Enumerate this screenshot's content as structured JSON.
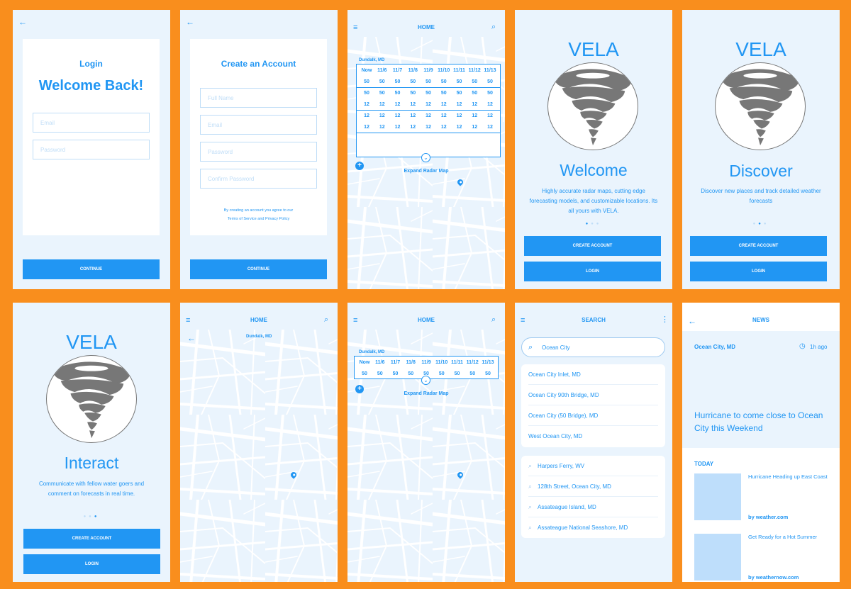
{
  "colors": {
    "background": "#F98E1D",
    "primary": "#2196F3",
    "screen_bg": "#EAF4FD",
    "tornado_gray": "#777777"
  },
  "icons": {
    "back": "arrow-left-icon",
    "menu": "hamburger-menu-icon",
    "search": "search-icon",
    "more": "more-vertical-icon",
    "add": "plus-circle-icon",
    "expand": "chevron-down-circle-icon",
    "location": "map-pin-icon",
    "clock": "clock-icon"
  },
  "login": {
    "title": "Login",
    "heading": "Welcome Back!",
    "email_placeholder": "Email",
    "password_placeholder": "Password",
    "continue_label": "CONTINUE"
  },
  "signup": {
    "title": "Create an Account",
    "full_name_placeholder": "Full Name",
    "email_placeholder": "Email",
    "password_placeholder": "Password",
    "confirm_placeholder": "Confirm Password",
    "terms_line1": "By creating an account you agree to our",
    "terms_line2": "Terms of Service and Privacy Policy",
    "continue_label": "CONTINUE"
  },
  "home": {
    "title": "HOME",
    "location": "Dundalk, MD",
    "expand_label": "Expand Radar Map",
    "headers": [
      "Now",
      "11/6",
      "11/7",
      "11/8",
      "11/9",
      "11/10",
      "11/11",
      "11/12",
      "11/13"
    ],
    "row1": [
      "50",
      "50",
      "50",
      "50",
      "50",
      "50",
      "50",
      "50",
      "50"
    ],
    "row2": [
      "50",
      "50",
      "50",
      "50",
      "50",
      "50",
      "50",
      "50",
      "50"
    ],
    "row3": [
      "12",
      "12",
      "12",
      "12",
      "12",
      "12",
      "12",
      "12",
      "12"
    ],
    "row4": [
      "12",
      "12",
      "12",
      "12",
      "12",
      "12",
      "12",
      "12",
      "12"
    ],
    "row5": [
      "12",
      "12",
      "12",
      "12",
      "12",
      "12",
      "12",
      "12",
      "12"
    ]
  },
  "onboarding": {
    "brand": "VELA",
    "welcome_title": "Welcome",
    "welcome_text": "Highly accurate radar maps, cutting edge forecasting models, and customizable locations. Its all yours with VELA.",
    "discover_title": "Discover",
    "discover_text": "Discover new places and track detailed weather forecasts",
    "interact_title": "Interact",
    "interact_text": "Communicate with fellow water goers and comment on forecasts in real time.",
    "create_label": "CREATE ACCOUNT",
    "login_label": "LOGIN"
  },
  "map_screen": {
    "title": "HOME",
    "location": "Dundalk, MD"
  },
  "search": {
    "title": "SEARCH",
    "query": "Ocean City",
    "results": [
      "Ocean City Inlet, MD",
      "Ocean City 90th Bridge, MD",
      "Ocean City (50 Bridge), MD",
      "West Ocean City, MD"
    ],
    "recent": [
      "Harpers Ferry, WV",
      "128th Street, Ocean City, MD",
      "Assateague Island, MD",
      "Assateague National Seashore, MD"
    ]
  },
  "news": {
    "title": "NEWS",
    "location": "Ocean City, MD",
    "time": "1h ago",
    "headline": "Hurricane to come close to Ocean City this Weekend",
    "section": "TODAY",
    "items": [
      {
        "title": "Hurricane Heading up East Coast",
        "source": "by weather.com"
      },
      {
        "title": "Get Ready for a Hot Summer",
        "source": "by weathernow.com"
      }
    ]
  }
}
